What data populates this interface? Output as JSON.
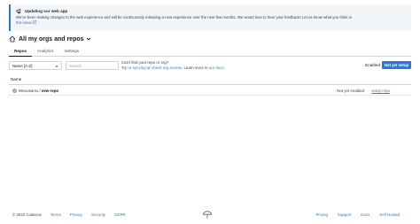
{
  "banner": {
    "title": "Updating our web app",
    "text": "We've been making changes to the web experience and will be continuously releasing a new experience over the next few months. We would love to hear your feedback! Let us know what you think in",
    "link": "this issue"
  },
  "page": {
    "title": "All my orgs and repos"
  },
  "tabs": [
    {
      "label": "Repos"
    },
    {
      "label": "Analytics"
    },
    {
      "label": "Settings"
    }
  ],
  "controls": {
    "sort_value": "Name [A-Z]",
    "search_placeholder": "Search",
    "help_line1": "Can't find your repo or org?",
    "help_try": "Try",
    "help_resync": "re-syncing",
    "help_or": "or",
    "help_check": "check org access.",
    "help_learn": "Learn more in",
    "help_docs": "our docs.",
    "enabled_label": "Enabled",
    "toggle_label": "Not yet setup"
  },
  "table": {
    "header_name": "Name",
    "rows": [
      {
        "owner": "Mesosiamu",
        "separator": "/",
        "repo": "new-repo",
        "status": "Not yet enabled",
        "action": "setup repo"
      }
    ]
  },
  "footer": {
    "copyright": "© 2023 Codecov",
    "terms": "Terms",
    "privacy": "Privacy",
    "security": "Security",
    "gdpr": "GDPR",
    "pricing": "Pricing",
    "support": "Support",
    "docs": "Docs",
    "self_hosted": "Self Hosted"
  },
  "colors": {
    "accent": "#2f78d2",
    "banner_bg": "#f3f6f9"
  },
  "icons": {
    "banner": "megaphone-icon",
    "title": "home-icon",
    "repo": "globe-icon",
    "footer": "umbrella-icon"
  }
}
